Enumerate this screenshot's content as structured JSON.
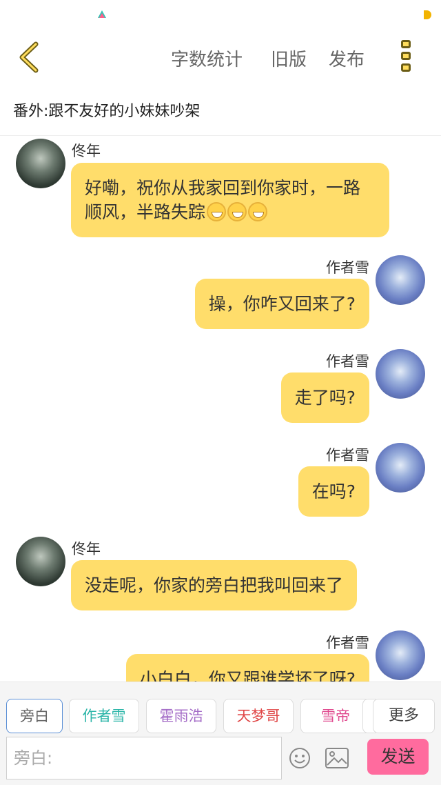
{
  "top_bar": {
    "word_count_label": "字数统计",
    "old_version_label": "旧版",
    "publish_label": "发布"
  },
  "chapter_title": "番外:跟不友好的小妹妹吵架",
  "messages": [
    {
      "sender": "佟年",
      "side": "left",
      "text": "好嘞，祝你从我家回到你家时，一路顺风，半路失踪",
      "emoji": [
        "grinning-face",
        "grinning-face",
        "grinning-face"
      ]
    },
    {
      "sender": "作者雪",
      "side": "right",
      "text": "操，你咋又回来了?"
    },
    {
      "sender": "作者雪",
      "side": "right",
      "text": "走了吗?"
    },
    {
      "sender": "作者雪",
      "side": "right",
      "text": "在吗?"
    },
    {
      "sender": "佟年",
      "side": "left",
      "text": "没走呢，你家的旁白把我叫回来了"
    },
    {
      "sender": "作者雪",
      "side": "right",
      "text": "小白白，你又跟谁学坏了呀?"
    }
  ],
  "roles": [
    {
      "label": "旁白",
      "color": "#666666"
    },
    {
      "label": "作者雪",
      "color": "#2bb5a8"
    },
    {
      "label": "霍雨浩",
      "color": "#a46cc7"
    },
    {
      "label": "天梦哥",
      "color": "#e04848"
    },
    {
      "label": "雪帝",
      "color": "#e04a8f"
    }
  ],
  "more_roles_label": "更多",
  "input": {
    "placeholder": "旁白:",
    "value": ""
  },
  "send_label": "发送",
  "colors": {
    "bubble": "#ffdd6b",
    "send": "#ff6b9e",
    "accent": "#ffdd5c"
  }
}
